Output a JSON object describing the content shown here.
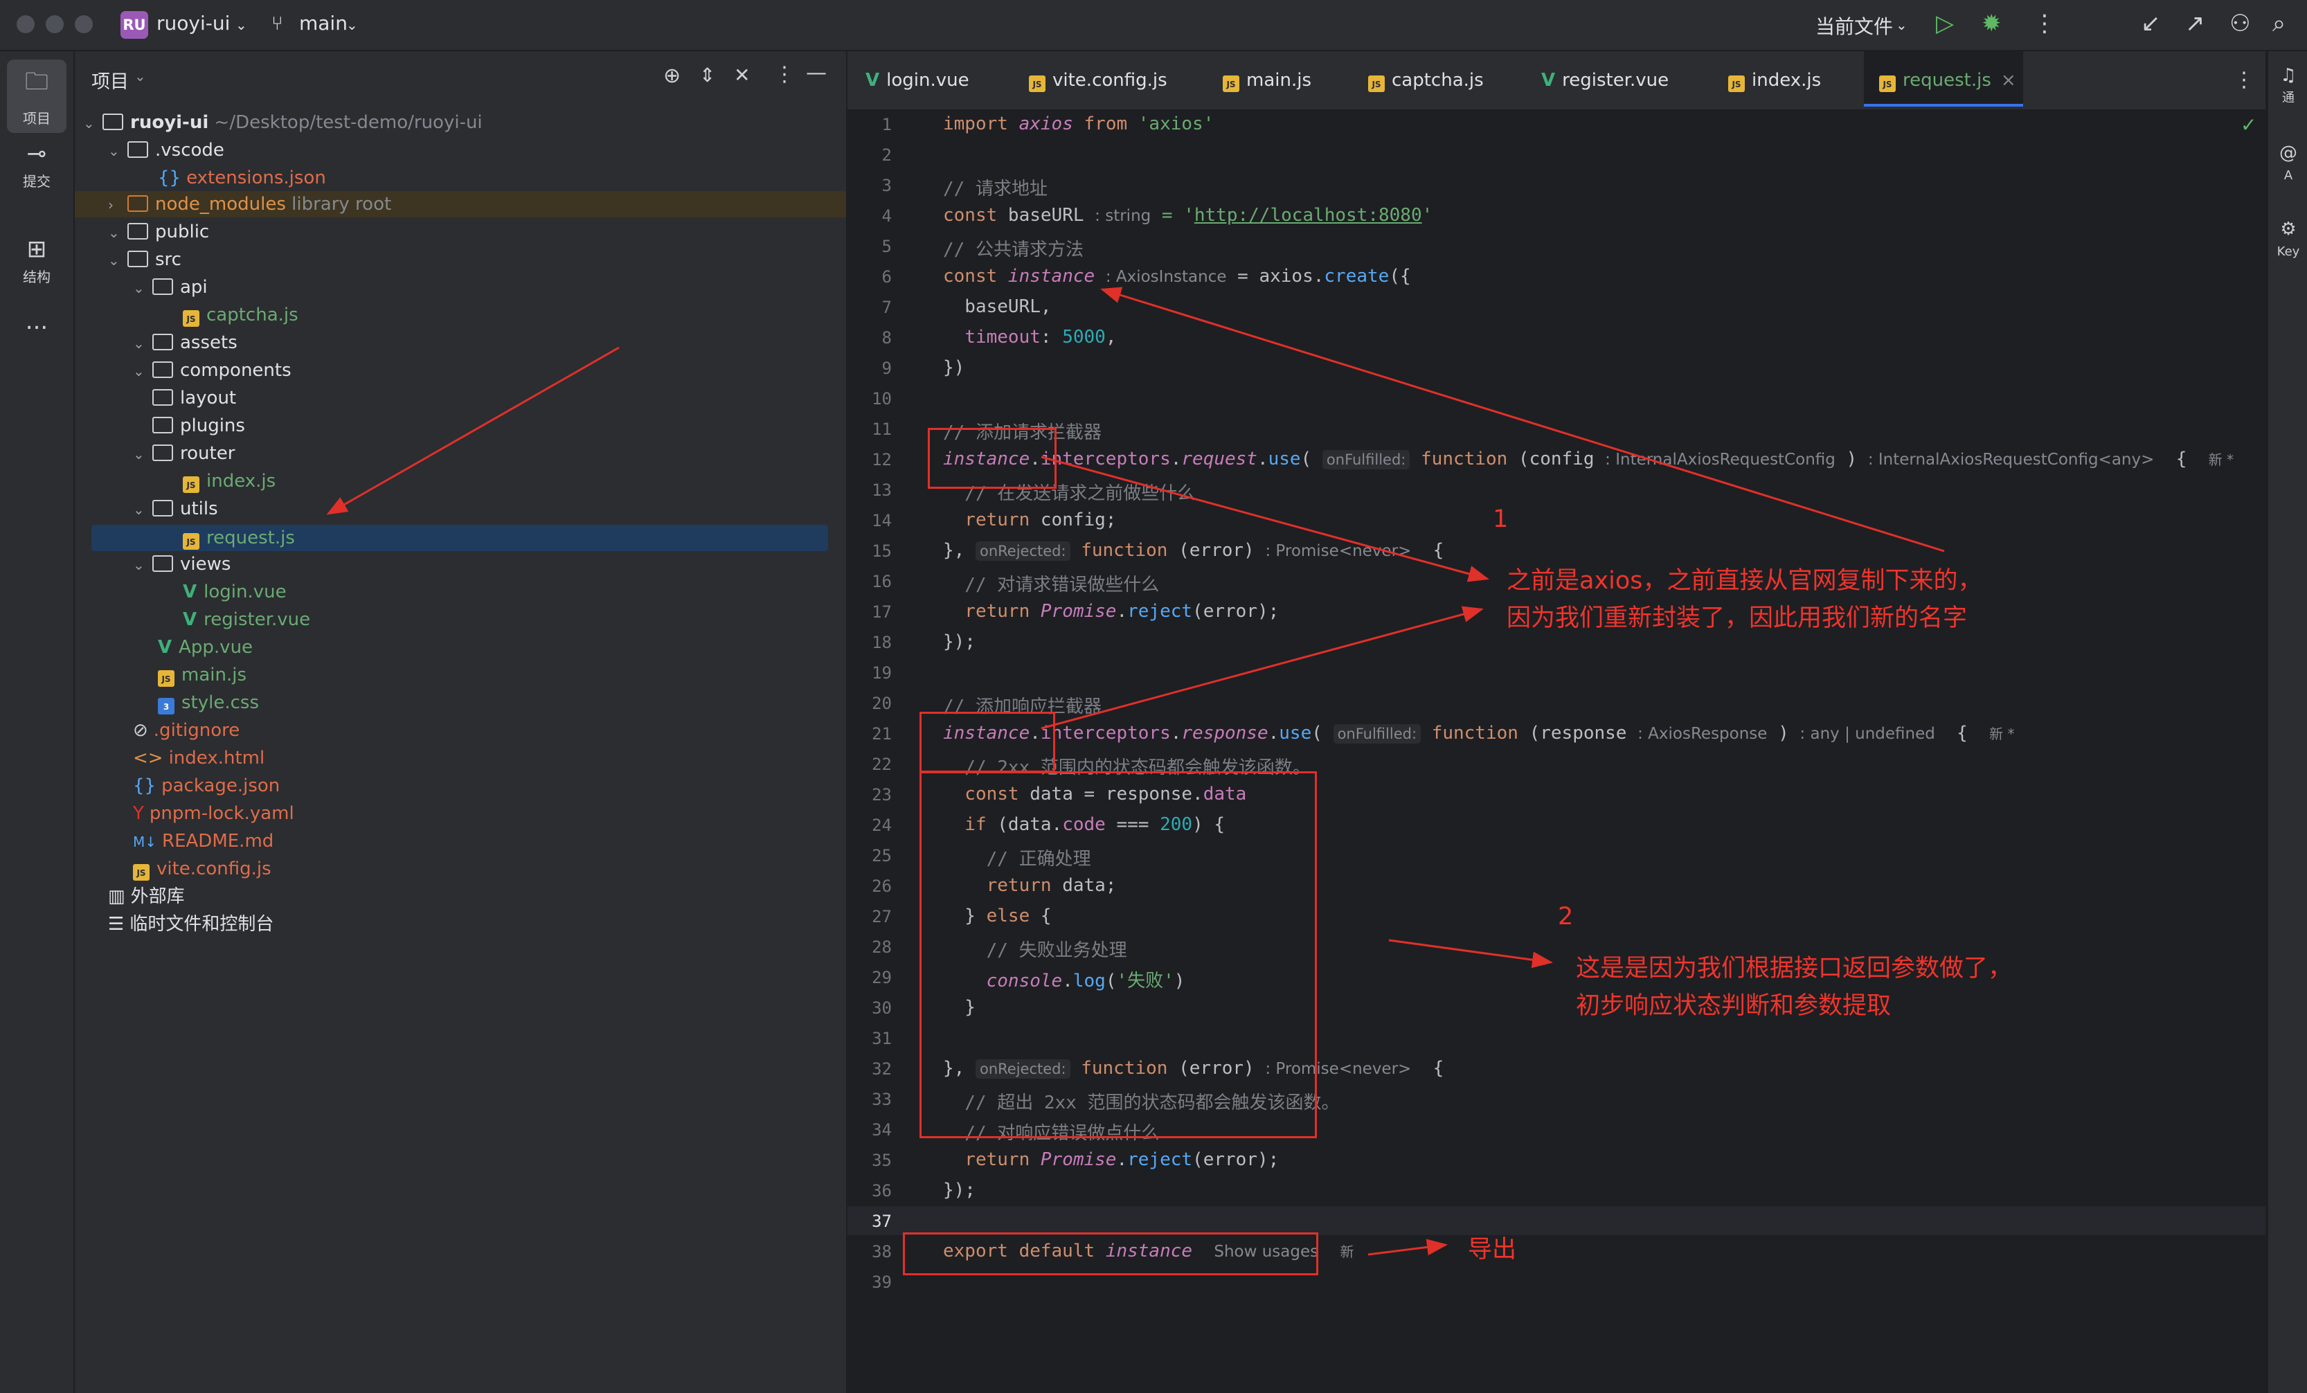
{
  "titlebar": {
    "project_badge": "RU",
    "project_name": "ruoyi-ui",
    "branch": "main",
    "run_config": "当前文件"
  },
  "left_strip": {
    "items": [
      {
        "label": "项目",
        "icon": "folder-icon"
      },
      {
        "label": "提交",
        "icon": "commit-icon"
      },
      {
        "label": "结构",
        "icon": "structure-icon"
      },
      {
        "label": "...",
        "icon": "more-icon"
      }
    ]
  },
  "project_panel": {
    "title": "项目",
    "root_name": "ruoyi-ui",
    "root_path": "~/Desktop/test-demo/ruoyi-ui",
    "node_modules_hint": "library root",
    "tree": [
      {
        "label": ".vscode"
      },
      {
        "label": "extensions.json"
      },
      {
        "label": "node_modules"
      },
      {
        "label": "public"
      },
      {
        "label": "src"
      },
      {
        "label": "api"
      },
      {
        "label": "captcha.js"
      },
      {
        "label": "assets"
      },
      {
        "label": "components"
      },
      {
        "label": "layout"
      },
      {
        "label": "plugins"
      },
      {
        "label": "router"
      },
      {
        "label": "index.js"
      },
      {
        "label": "utils"
      },
      {
        "label": "request.js"
      },
      {
        "label": "views"
      },
      {
        "label": "login.vue"
      },
      {
        "label": "register.vue"
      },
      {
        "label": "App.vue"
      },
      {
        "label": "main.js"
      },
      {
        "label": "style.css"
      },
      {
        "label": ".gitignore"
      },
      {
        "label": "index.html"
      },
      {
        "label": "package.json"
      },
      {
        "label": "pnpm-lock.yaml"
      },
      {
        "label": "README.md"
      },
      {
        "label": "vite.config.js"
      },
      {
        "label": "外部库"
      },
      {
        "label": "临时文件和控制台"
      }
    ]
  },
  "tabs": [
    {
      "label": "login.vue"
    },
    {
      "label": "vite.config.js"
    },
    {
      "label": "main.js"
    },
    {
      "label": "captcha.js"
    },
    {
      "label": "register.vue"
    },
    {
      "label": "index.js"
    },
    {
      "label": "request.js"
    }
  ],
  "code": {
    "l1_a": "import ",
    "l1_b": "axios",
    "l1_c": " from ",
    "l1_d": "'axios'",
    "l3": "// 请求地址",
    "l4_a": "const ",
    "l4_b": "baseURL",
    "l4_hint": ": string",
    "l4_c": " = '",
    "l4_url": "http://localhost:8080",
    "l4_d": "'",
    "l5": "// 公共请求方法",
    "l6_a": "const ",
    "l6_b": "instance",
    "l6_hint": ": AxiosInstance",
    "l6_c": " = axios.",
    "l6_d": "create",
    "l6_e": "({",
    "l7": "  baseURL,",
    "l8_a": "  ",
    "l8_b": "timeout",
    "l8_c": ": ",
    "l8_d": "5000",
    "l8_e": ",",
    "l9": "})",
    "l11": "// 添加请求拦截器",
    "l12_a": "instance",
    "l12_b": ".",
    "l12_c": "interceptors",
    "l12_d": ".",
    "l12_e": "request",
    "l12_f": ".",
    "l12_g": "use",
    "l12_h": "(",
    "l12_box": "onFulfilled:",
    "l12_i": "function",
    "l12_j": " (config",
    "l12_hint1": ": InternalAxiosRequestConfig",
    "l12_k": " )",
    "l12_hint2": ": InternalAxiosRequestConfig<any>",
    "l12_l": "  {",
    "l12_new": "新 *",
    "l13": "  // 在发送请求之前做些什么",
    "l14_a": "  return ",
    "l14_b": "config;",
    "l15_a": "}, ",
    "l15_box": "onRejected:",
    "l15_b": " function",
    "l15_c": " (error)",
    "l15_hint": ": Promise<never>",
    "l15_d": "  {",
    "l16": "  // 对请求错误做些什么",
    "l17_a": "  return ",
    "l17_b": "Promise",
    "l17_c": ".",
    "l17_d": "reject",
    "l17_e": "(error);",
    "l18": "});",
    "l20": "// 添加响应拦截器",
    "l21_a": "instance",
    "l21_b": ".",
    "l21_c": "interceptors",
    "l21_d": ".",
    "l21_e": "response",
    "l21_f": ".",
    "l21_g": "use",
    "l21_h": "(",
    "l21_box": "onFulfilled:",
    "l21_i": "function",
    "l21_j": " (response",
    "l21_hint1": ": AxiosResponse",
    "l21_k": " )",
    "l21_hint2": ": any | undefined",
    "l21_l": "  {",
    "l21_new": "新 *",
    "l22": "  // 2xx 范围内的状态码都会触发该函数。",
    "l23_a": "  const ",
    "l23_b": "data = response.",
    "l23_c": "data",
    "l24_a": "  if ",
    "l24_b": "(data.",
    "l24_c": "code",
    "l24_d": " === ",
    "l24_e": "200",
    "l24_f": ") {",
    "l25": "    // 正确处理",
    "l26_a": "    return ",
    "l26_b": "data;",
    "l27_a": "  } ",
    "l27_b": "else",
    "l27_c": " {",
    "l28": "    // 失败业务处理",
    "l29_a": "    ",
    "l29_b": "console",
    "l29_c": ".",
    "l29_d": "log",
    "l29_e": "(",
    "l29_f": "'失败'",
    "l29_g": ")",
    "l30": "  }",
    "l32_a": "}, ",
    "l32_box": "onRejected:",
    "l32_b": " function",
    "l32_c": " (error)",
    "l32_hint": ": Promise<never>",
    "l32_d": "  {",
    "l33": "  // 超出 2xx 范围的状态码都会触发该函数。",
    "l34": "  // 对响应错误做点什么",
    "l35_a": "  return ",
    "l35_b": "Promise",
    "l35_c": ".",
    "l35_d": "reject",
    "l35_e": "(error);",
    "l36": "});",
    "l38_a": "export default ",
    "l38_b": "instance",
    "l38_usages": "Show usages",
    "l38_new": "新"
  },
  "annotations": {
    "num1": "1",
    "text1_line1": "之前是axios，之前直接从官网复制下来的，",
    "text1_line2": "因为我们重新封装了，因此用我们新的名字",
    "num2": "2",
    "text2_line1": "这是是因为我们根据接口返回参数做了，",
    "text2_line2": "初步响应状态判断和参数提取",
    "export_note": "导出",
    "color": "#f0342c"
  },
  "right_strip": {
    "items": [
      {
        "label": "通"
      },
      {
        "label": "A"
      },
      {
        "label": "Key"
      }
    ]
  }
}
